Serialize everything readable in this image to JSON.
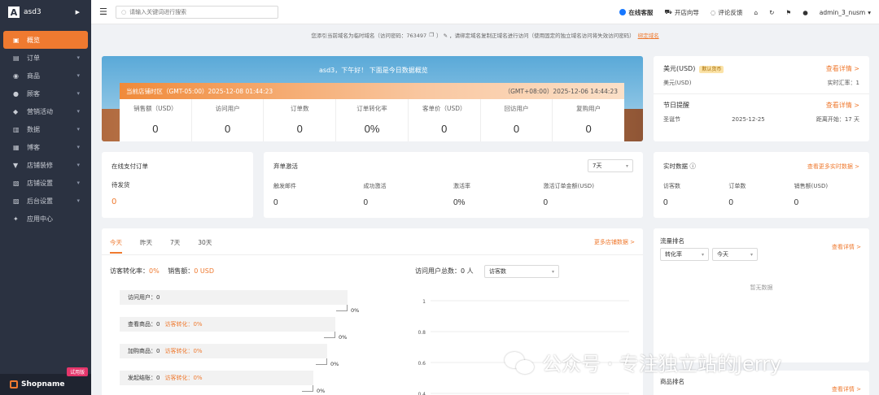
{
  "sidebar": {
    "store_name": "asd3",
    "items": [
      {
        "label": "概览",
        "icon": "home-icon",
        "active": true
      },
      {
        "label": "订单",
        "icon": "order-icon",
        "has_children": true
      },
      {
        "label": "商品",
        "icon": "product-icon",
        "has_children": true
      },
      {
        "label": "顾客",
        "icon": "customer-icon",
        "has_children": true
      },
      {
        "label": "营销活动",
        "icon": "marketing-icon",
        "has_children": true
      },
      {
        "label": "数据",
        "icon": "data-icon",
        "has_children": true
      },
      {
        "label": "博客",
        "icon": "blog-icon",
        "has_children": true
      },
      {
        "label": "店铺装修",
        "icon": "decor-icon",
        "has_children": true
      },
      {
        "label": "店铺设置",
        "icon": "store-settings-icon",
        "has_children": true
      },
      {
        "label": "后台设置",
        "icon": "admin-settings-icon",
        "has_children": true
      },
      {
        "label": "应用中心",
        "icon": "apps-icon",
        "has_children": false
      }
    ],
    "brand": "Shopname",
    "trial_badge": "试用版"
  },
  "topbar": {
    "search_placeholder": "请输入关键词进行搜索",
    "online_service": "在线客服",
    "open_store_guide": "开店向导",
    "feedback": "评论反馈",
    "username": "admin_3_nusm"
  },
  "notice": {
    "text": "您添引当前域名为临时域名（访问密码：763497",
    "text2": "）  ✎  ，请绑定域名复制正域名进行访问（使用固定的独立域名访问将失效访问密码）",
    "link": "绑定域名"
  },
  "banner": {
    "greeting": "asd3，下午好！ 下面是今日数据概览",
    "store_time": "当前店铺时区（GMT-05:00）2025-12-08 01:44:23",
    "local_time": "（GMT+08:00）2025-12-06 14:44:23",
    "stats": [
      {
        "label": "销售额（USD）",
        "value": "0"
      },
      {
        "label": "访问用户",
        "value": "0"
      },
      {
        "label": "订单数",
        "value": "0"
      },
      {
        "label": "订单转化率",
        "value": "0%"
      },
      {
        "label": "客单价（USD）",
        "value": "0"
      },
      {
        "label": "回访用户",
        "value": "0"
      },
      {
        "label": "复购用户",
        "value": "0"
      }
    ]
  },
  "currency": {
    "name": "美元(USD)",
    "default_tag": "默认货币",
    "view_detail": "查看详情 >",
    "sub_name": "美元(USD)",
    "rate_label": "实时汇率：1",
    "holiday_title": "节日提醒",
    "holiday_view": "查看详情 >",
    "holiday_name": "圣诞节",
    "holiday_date": "2025-12-25",
    "countdown": "距离开始：17 天"
  },
  "pay_card": {
    "title": "在线支付订单",
    "label": "待发货",
    "value": "0"
  },
  "abandon_card": {
    "title": "弃单激活",
    "period": "7天",
    "items": [
      {
        "label": "触发邮件",
        "value": "0"
      },
      {
        "label": "成功激活",
        "value": "0"
      },
      {
        "label": "激活率",
        "value": "0%"
      },
      {
        "label": "激活订单金额(USD)",
        "value": "0"
      }
    ]
  },
  "realtime": {
    "title": "实时数据",
    "more": "查看更多实时数据 >",
    "items": [
      {
        "label": "访客数",
        "value": "0"
      },
      {
        "label": "订单数",
        "value": "0"
      },
      {
        "label": "销售额(USD)",
        "value": "0"
      }
    ]
  },
  "analytics": {
    "tabs": [
      "今天",
      "昨天",
      "7天",
      "30天"
    ],
    "more": "更多店铺数据 >",
    "conversion_label": "访客转化率：",
    "conversion_value": "0%",
    "sales_label": "销售额：",
    "sales_value": "0 USD",
    "funnel": [
      {
        "label": "访问用户：0",
        "extra": "",
        "pct": "0%"
      },
      {
        "label": "查看商品：0",
        "extra": "访客转化：0%",
        "pct": "0%"
      },
      {
        "label": "加购商品：0",
        "extra": "访客转化：0%",
        "pct": "0%"
      },
      {
        "label": "发起结账：0",
        "extra": "访客转化：0%",
        "pct": "0%"
      }
    ],
    "visit_total_label": "访问用户总数：",
    "visit_total_value": "0 人",
    "visit_select": "访客数"
  },
  "chart_data": {
    "type": "line",
    "categories": [],
    "series": [],
    "ylim": [
      0,
      1
    ],
    "yticks": [
      "1",
      "0.8",
      "0.6",
      "0.4"
    ]
  },
  "traffic_rank": {
    "title": "流量排名",
    "view": "查看详情 >",
    "select1": "转化率",
    "select2": "今天",
    "empty": "暂无数据"
  },
  "product_rank": {
    "title": "商品排名",
    "view": "查看详情 >"
  },
  "watermark": {
    "text": "公众号 · 专注独立站的Jerry"
  },
  "colors": {
    "accent": "#ef7a30",
    "sidebar": "#2b3241",
    "blue": "#1677ff"
  }
}
